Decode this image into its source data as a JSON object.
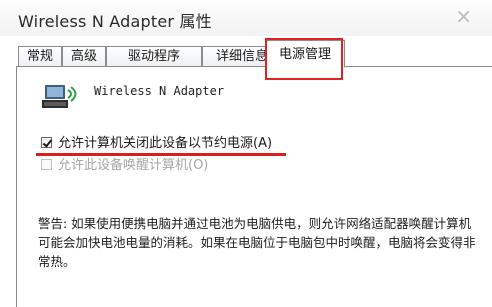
{
  "window": {
    "title": "Wireless N Adapter 属性",
    "close_glyph": "×"
  },
  "tabs": [
    {
      "label": "常规",
      "active": false
    },
    {
      "label": "高级",
      "active": false
    },
    {
      "label": "驱动程序",
      "active": false
    },
    {
      "label": "详细信息",
      "active": false
    },
    {
      "label": "电源管理",
      "active": true
    }
  ],
  "device": {
    "icon": "network-adapter-icon",
    "name": "Wireless N Adapter"
  },
  "options": [
    {
      "label": "允许计算机关闭此设备以节约电源(A)",
      "checked": true,
      "enabled": true
    },
    {
      "label": "允许此设备唤醒计算机(O)",
      "checked": false,
      "enabled": false
    }
  ],
  "warning": "警告: 如果使用便携电脑并通过电池为电脑供电，则允许网络适配器唤醒计算机可能会加快电池电量的消耗。如果在电脑位于电脑包中时唤醒，电脑将会变得非常热。",
  "annotations": {
    "highlight_color": "#e02222"
  }
}
